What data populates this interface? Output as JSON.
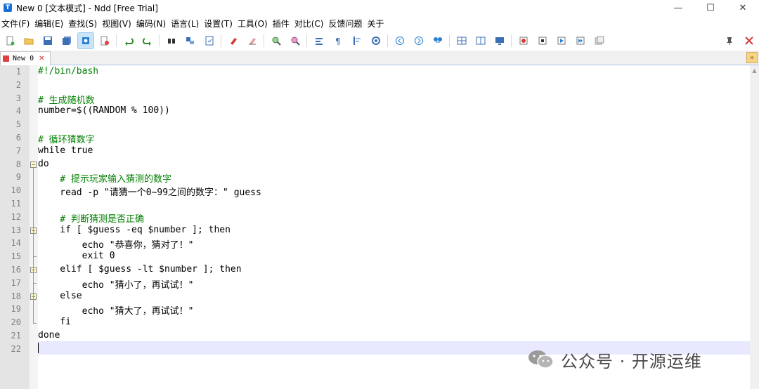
{
  "window": {
    "title": "New 0 [文本模式] - Ndd [Free Trial]",
    "controls": {
      "minimize": "—",
      "maximize": "☐",
      "close": "✕"
    }
  },
  "menu": {
    "items": [
      "文件(F)",
      "编辑(E)",
      "查找(S)",
      "视图(V)",
      "编码(N)",
      "语言(L)",
      "设置(T)",
      "工具(O)",
      "插件",
      "对比(C)",
      "反馈问题",
      "关于"
    ]
  },
  "toolbar": {
    "icons": [
      "new-file-icon",
      "open-folder-icon",
      "save-icon",
      "save-all-icon",
      "file-mode-icon",
      "close-file-icon",
      "undo-icon",
      "redo-icon",
      "find-icon",
      "replace-icon",
      "goto-icon",
      "highlight-icon",
      "eraser-icon",
      "zoom-in-icon",
      "zoom-out-icon",
      "wrap-icon",
      "show-all-chars-icon",
      "indent-guide-icon",
      "record-icon",
      "back-icon",
      "forward-icon",
      "compare-icon",
      "split-icon",
      "column-icon",
      "monitor-icon",
      "macro-record-icon",
      "macro-stop-icon",
      "macro-play-icon",
      "macro-run-multiple-icon",
      "macro-save-icon"
    ],
    "pin_icon": "pin-icon",
    "close_icon": "close-red-icon"
  },
  "tabs": [
    {
      "label": "New 0",
      "close": "✕"
    }
  ],
  "tab_dropdown": "»",
  "editor": {
    "lines": [
      {
        "num": "1",
        "text": "#!/bin/bash",
        "type": "comment"
      },
      {
        "num": "2",
        "text": "",
        "type": "code"
      },
      {
        "num": "3",
        "text": "# 生成随机数",
        "type": "comment"
      },
      {
        "num": "4",
        "text": "number=$((RANDOM % 100))",
        "type": "code"
      },
      {
        "num": "5",
        "text": "",
        "type": "code"
      },
      {
        "num": "6",
        "text": "# 循环猜数字",
        "type": "comment"
      },
      {
        "num": "7",
        "text": "while true",
        "type": "code"
      },
      {
        "num": "8",
        "text": "do",
        "type": "code"
      },
      {
        "num": "9",
        "text": "    # 提示玩家输入猜测的数字",
        "type": "comment"
      },
      {
        "num": "10",
        "text": "    read -p \"请猜一个0~99之间的数字：\" guess",
        "type": "code"
      },
      {
        "num": "11",
        "text": "",
        "type": "code"
      },
      {
        "num": "12",
        "text": "    # 判断猜测是否正确",
        "type": "comment"
      },
      {
        "num": "13",
        "text": "    if [ $guess -eq $number ]; then",
        "type": "code"
      },
      {
        "num": "14",
        "text": "        echo \"恭喜你，猜对了！\"",
        "type": "code"
      },
      {
        "num": "15",
        "text": "        exit 0",
        "type": "code"
      },
      {
        "num": "16",
        "text": "    elif [ $guess -lt $number ]; then",
        "type": "code"
      },
      {
        "num": "17",
        "text": "        echo \"猜小了，再试试！\"",
        "type": "code"
      },
      {
        "num": "18",
        "text": "    else",
        "type": "code"
      },
      {
        "num": "19",
        "text": "        echo \"猜大了，再试试！\"",
        "type": "code"
      },
      {
        "num": "20",
        "text": "    fi",
        "type": "code"
      },
      {
        "num": "21",
        "text": "done",
        "type": "code"
      },
      {
        "num": "22",
        "text": "",
        "type": "code"
      }
    ]
  },
  "watermark": {
    "text": "公众号 · 开源运维",
    "icon": "wechat-icon"
  }
}
